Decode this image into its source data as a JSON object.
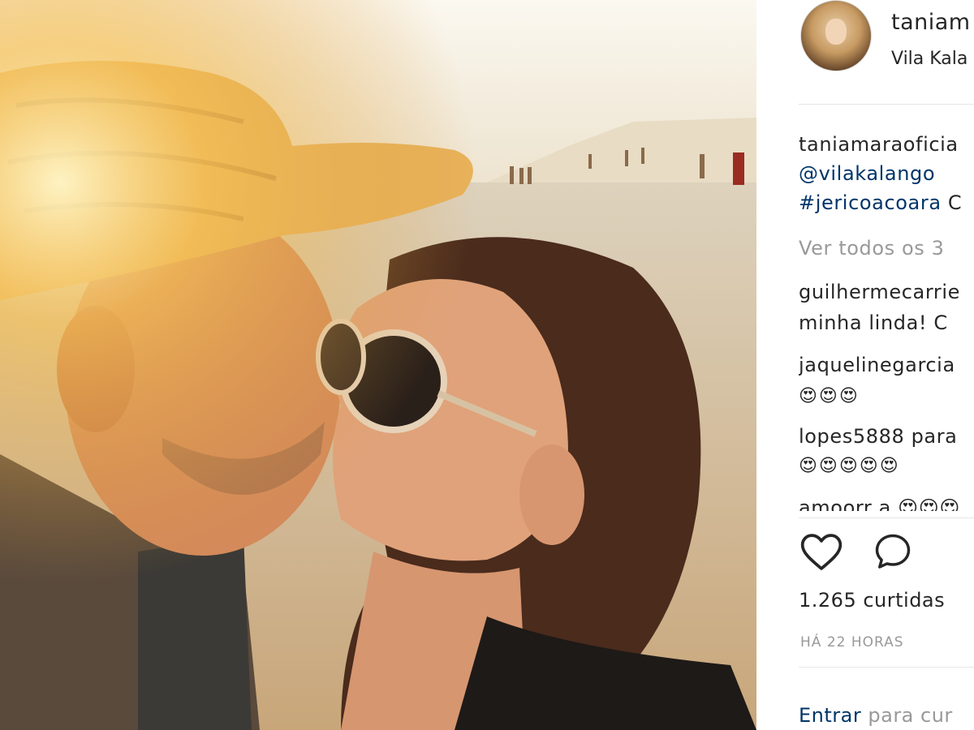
{
  "post": {
    "username": "taniam",
    "location": "Vila Kala",
    "caption": {
      "author": "taniamaraoficia",
      "mention": "@vilakalango",
      "hashtag": "#jericoacoara",
      "hashtag_suffix": "C"
    },
    "view_all": "Ver todos os 3",
    "comments": [
      {
        "user": "guilhermecarrie",
        "text": "minha linda! C"
      },
      {
        "user": "jaquelinegarcia",
        "text": "😍😍😍"
      },
      {
        "user": "lopes5888",
        "user_suffix": "para",
        "text": "😍😍😍😍😍"
      },
      {
        "user": "amoorr",
        "text": "amoorr a 😍😍😍"
      }
    ],
    "likes": "1.265 curtidas",
    "time": "HÁ 22 HORAS",
    "login": {
      "link": "Entrar",
      "rest": "para cur"
    }
  },
  "icons": {
    "like": "heart-icon",
    "comment": "comment-icon"
  },
  "colors": {
    "link": "#003569",
    "muted": "#999999",
    "text": "#262626"
  }
}
